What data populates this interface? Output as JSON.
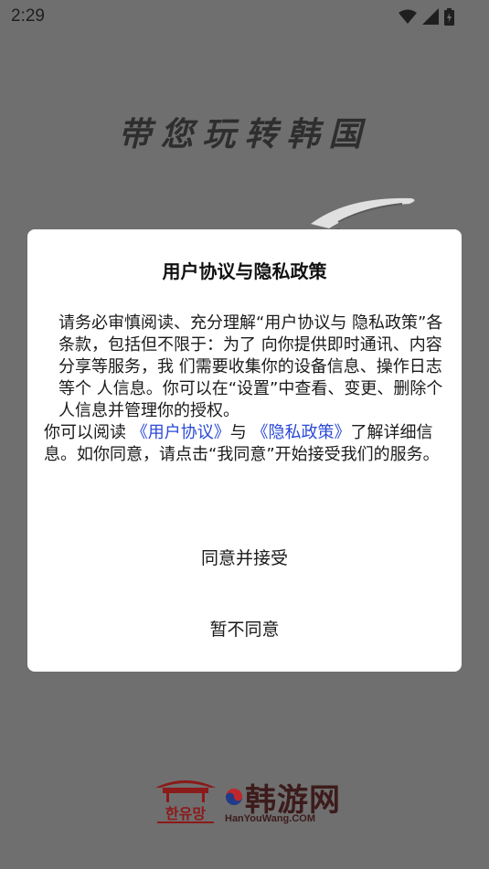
{
  "status_bar": {
    "time": "2:29",
    "icons": [
      "wifi-icon",
      "signal-icon",
      "battery-icon"
    ]
  },
  "splash": {
    "slogan": "带您玩转韩国",
    "brand_name": "韩游网",
    "brand_domain": "HanYouWang.COM",
    "brand_korean": "한유망"
  },
  "dialog": {
    "title": "用户协议与隐私政策",
    "paragraph1": "请务必审慎阅读、充分理解“用户协议与 隐私政策”各条款，包括但不限于：为了 向你提供即时通讯、内容分享等服务，我 们需要收集你的设备信息、操作日志等个 人信息。你可以在“设置”中查看、变更、删除个人信息并管理你的授权。",
    "p2_prefix": "你可以阅读 ",
    "user_agreement_link": "《用户协议》",
    "p2_and": "与 ",
    "privacy_policy_link": "《隐私政策》",
    "p2_suffix": "了解详细信息。如你同意，请点击“我同意”开始接受我们的服务。",
    "agree_button": "同意并接受",
    "decline_button": "暂不同意"
  },
  "colors": {
    "overlay": "#6f6f6f",
    "dialog_bg": "#ffffff",
    "link": "#2a49d6",
    "brand": "#3d1b1b"
  }
}
